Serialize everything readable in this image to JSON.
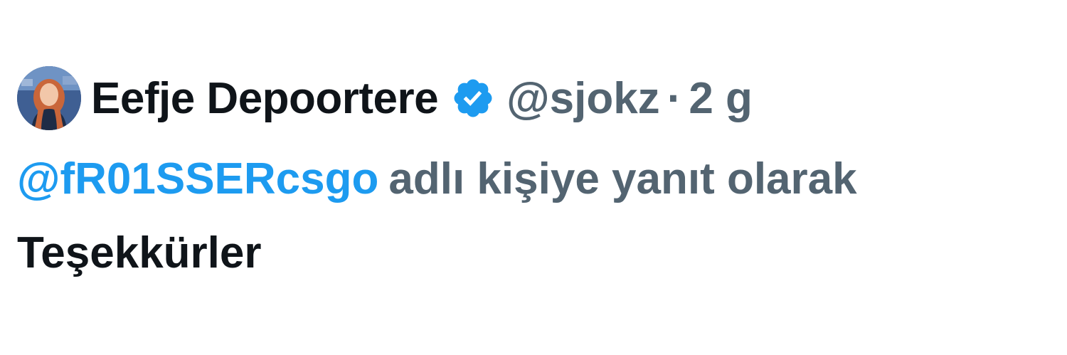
{
  "tweet": {
    "author": {
      "display_name": "Eefje Depoortere",
      "handle": "@sjokz",
      "verified": true,
      "verified_badge_color": "#1d9bf0"
    },
    "separator": "·",
    "timestamp": "2 g",
    "reply_context": {
      "mention": "@fR01SSERcsgo",
      "text": "adlı kişiye yanıt olarak"
    },
    "text": "Teşekkürler"
  },
  "colors": {
    "primary_text": "#0f1419",
    "secondary_text": "#536471",
    "link": "#1d9bf0",
    "background": "#ffffff"
  }
}
